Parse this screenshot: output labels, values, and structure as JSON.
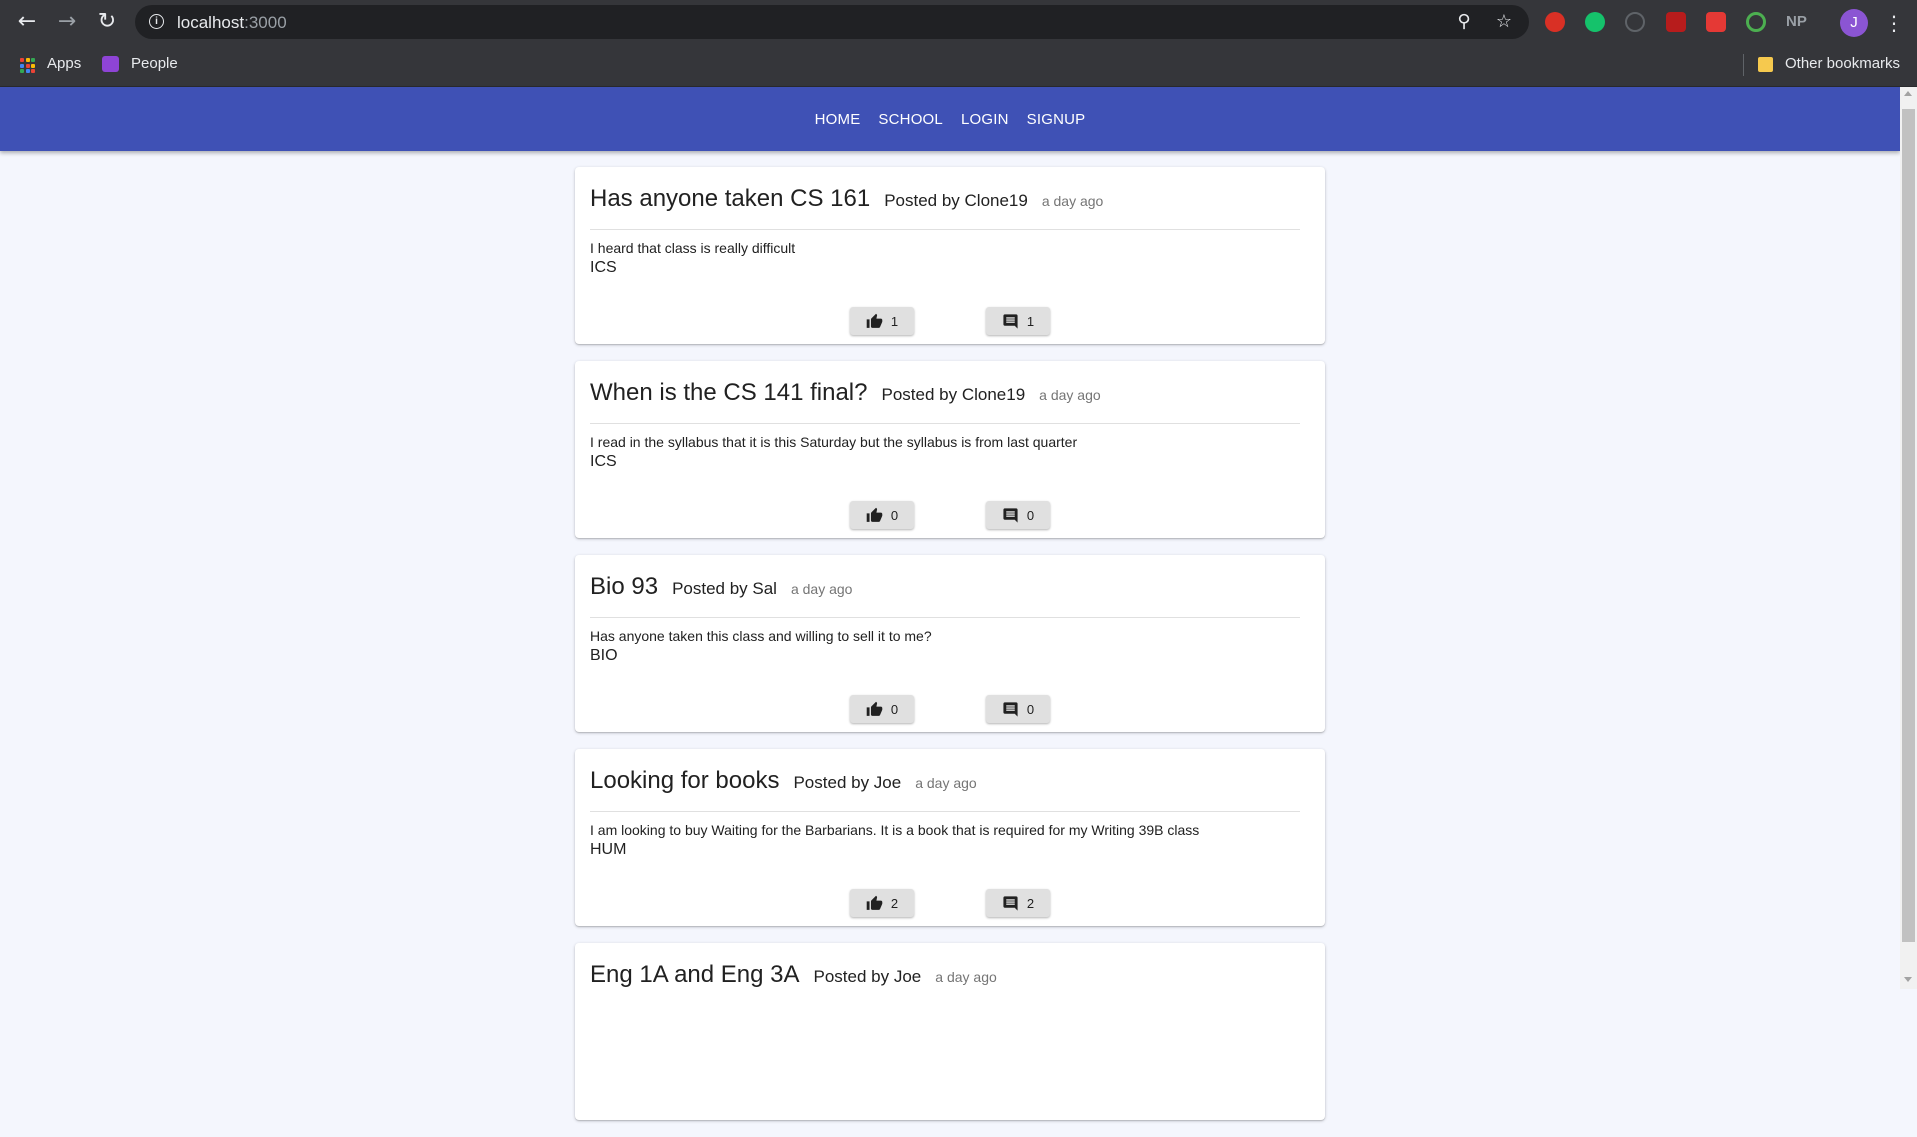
{
  "browser": {
    "url_host": "localhost",
    "url_port": ":3000",
    "bookmarks": {
      "apps_label": "Apps",
      "people_label": "People",
      "other_label": "Other bookmarks"
    },
    "extensions": [
      "adblock-icon",
      "grammarly-icon",
      "sync-icon",
      "pdf-icon",
      "fox-icon",
      "target-icon",
      "np-icon"
    ],
    "profile_initial": "J"
  },
  "nav": {
    "links": [
      "HOME",
      "SCHOOL",
      "LOGIN",
      "SIGNUP"
    ]
  },
  "posts": [
    {
      "title": "Has anyone taken CS 161",
      "author": "Posted by Clone19",
      "time": "a day ago",
      "body": "I heard that class is really difficult",
      "tag": "ICS",
      "likes": "1",
      "comments": "1"
    },
    {
      "title": "When is the CS 141 final?",
      "author": "Posted by Clone19",
      "time": "a day ago",
      "body": "I read in the syllabus that it is this Saturday but the syllabus is from last quarter",
      "tag": "ICS",
      "likes": "0",
      "comments": "0"
    },
    {
      "title": "Bio 93",
      "author": "Posted by Sal",
      "time": "a day ago",
      "body": "Has anyone taken this class and willing to sell it to me?",
      "tag": "BIO",
      "likes": "0",
      "comments": "0"
    },
    {
      "title": "Looking for books",
      "author": "Posted by Joe",
      "time": "a day ago",
      "body": "I am looking to buy Waiting for the Barbarians. It is a book that is required for my Writing 39B class",
      "tag": "HUM",
      "likes": "2",
      "comments": "2"
    },
    {
      "title": "Eng 1A and Eng 3A",
      "author": "Posted by Joe",
      "time": "a day ago",
      "body": "",
      "tag": "",
      "likes": "",
      "comments": ""
    }
  ],
  "colors": {
    "appbar": "#3f51b5",
    "page_bg": "#f4f6fd"
  }
}
